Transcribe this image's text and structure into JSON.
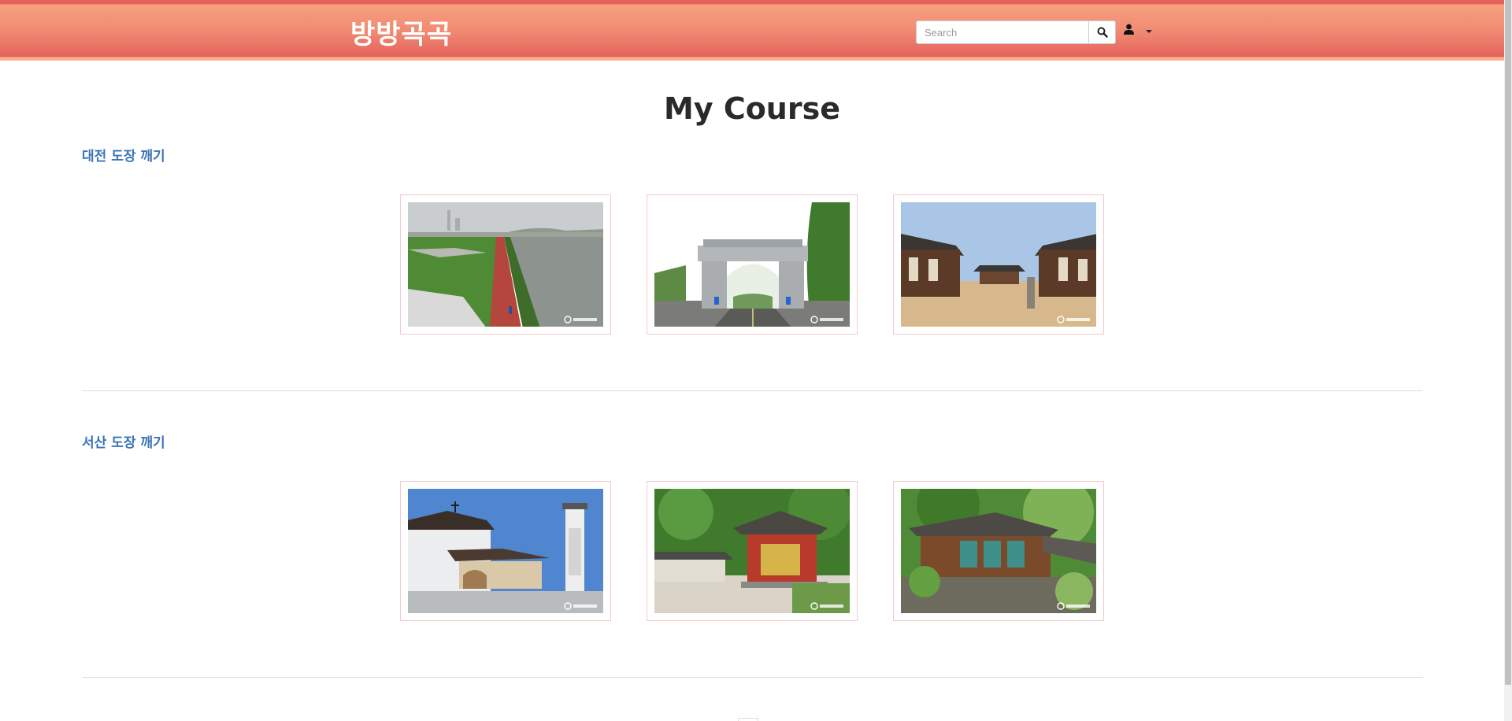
{
  "header": {
    "brand": "방방곡곡",
    "search": {
      "placeholder": "Search",
      "value": ""
    },
    "search_button_icon": "search-icon",
    "user_menu_icon": "user-icon"
  },
  "page": {
    "title": "My Course"
  },
  "sections": [
    {
      "title": "대전 도장 깨기",
      "images": [
        {
          "subject": "riverside-bike-path"
        },
        {
          "subject": "stone-gate"
        },
        {
          "subject": "hanok-courtyard"
        }
      ]
    },
    {
      "title": "서산 도장 깨기",
      "images": [
        {
          "subject": "church-with-tower"
        },
        {
          "subject": "red-temple-hall"
        },
        {
          "subject": "temple-in-forest"
        }
      ]
    }
  ],
  "colors": {
    "header_top": "#e5625a",
    "header_bottom": "#f9b08a",
    "section_title": "#3a74b8",
    "card_border": "#f3c9cc"
  }
}
